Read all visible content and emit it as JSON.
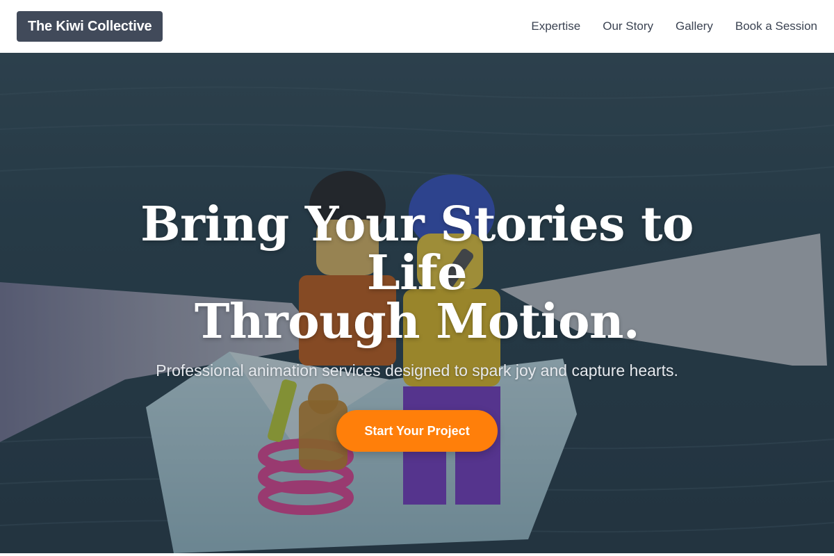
{
  "header": {
    "brand": "The Kiwi Collective",
    "nav": [
      {
        "label": "Expertise"
      },
      {
        "label": "Our Story"
      },
      {
        "label": "Gallery"
      },
      {
        "label": "Book a Session"
      }
    ]
  },
  "hero": {
    "title_line1": "Bring Your Stories to Life",
    "title_line2": "Through Motion.",
    "subtitle": "Professional animation services designed to spark joy and capture hearts.",
    "cta_label": "Start Your Project",
    "background_icon": "lego-figures-in-paper-boat-photo"
  },
  "colors": {
    "brand_bg": "#414a5a",
    "accent": "#ff7f0a",
    "nav_text": "#3b4352",
    "hero_text": "#ffffff"
  }
}
